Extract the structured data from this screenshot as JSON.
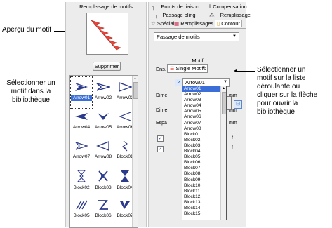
{
  "callouts": {
    "left_top": "Aperçu du motif",
    "left_bottom": [
      "Sélectionner un",
      "motif dans la",
      "bibliothèque"
    ],
    "right": [
      "Sélectionner un",
      "motif sur la liste",
      "déroulante ou",
      "cliquer sur la flèche",
      "pour ouvrir la",
      "bibliothèque"
    ]
  },
  "left_panel": {
    "preview_title": "Remplissage de motifs",
    "delete_label": "Supprimer",
    "patterns": [
      {
        "label": "Arrow01",
        "icon": "arrow-solid-right-icon",
        "selected": true
      },
      {
        "label": "Arrow02",
        "icon": "arrow-thin-right-icon"
      },
      {
        "label": "Arrow03",
        "icon": "arrow-outline-right-icon"
      },
      {
        "label": "Arrow04",
        "icon": "arrow-solid-left-icon"
      },
      {
        "label": "Arrow05",
        "icon": "chevron-down-icon"
      },
      {
        "label": "Arrow06",
        "icon": "chevron-left-thin-icon"
      },
      {
        "label": "Arrow07",
        "icon": "arrow-outline-right-2-icon"
      },
      {
        "label": "Arrow08",
        "icon": "arrow-outline-left-icon"
      },
      {
        "label": "Block01",
        "icon": "block-knot-icon"
      },
      {
        "label": "Block02",
        "icon": "block-hourglass-icon"
      },
      {
        "label": "Block03",
        "icon": "block-x-icon"
      },
      {
        "label": "Block04",
        "icon": "block-bowtie-icon"
      },
      {
        "label": "Block05",
        "icon": "block-hatch-icon"
      },
      {
        "label": "Block06",
        "icon": "block-zigzag-icon"
      },
      {
        "label": "Block07",
        "icon": "block-v-icon"
      }
    ]
  },
  "right_panel": {
    "tabs_row1": [
      "Points de liaison",
      "Compensation"
    ],
    "tabs_row2": [
      "Passage bling",
      "Remplissage"
    ],
    "tabs_row3": [
      "Spécial",
      "Remplissages",
      "Contour"
    ],
    "stitch_type": "Passage de motifs",
    "group_title": "Motif",
    "ens_label": "Ens.",
    "ens_value": "Single Motifs",
    "motif_value": "Arrow01",
    "dime1": "Dime",
    "dime2": "Dime",
    "espa": "Espa",
    "mm1": "mm",
    "mm2": "mm",
    "mm3": "mm",
    "chk1_suffix": "f",
    "chk2_suffix": "f",
    "dropdown_items": [
      "Arrow01",
      "Arrow02",
      "Arrow03",
      "Arrow04",
      "Arrow05",
      "Arrow06",
      "Arrow07",
      "Arrow08",
      "Block01",
      "Block02",
      "Block03",
      "Block04",
      "Block05",
      "Block06",
      "Block07",
      "Block08",
      "Block09",
      "Block10",
      "Block11",
      "Block12",
      "Block13",
      "Block14",
      "Block15"
    ]
  },
  "colors": {
    "selection": "#3b6ed6",
    "motif_red": "#e8443a",
    "icon_blue": "#2b3a8c"
  }
}
